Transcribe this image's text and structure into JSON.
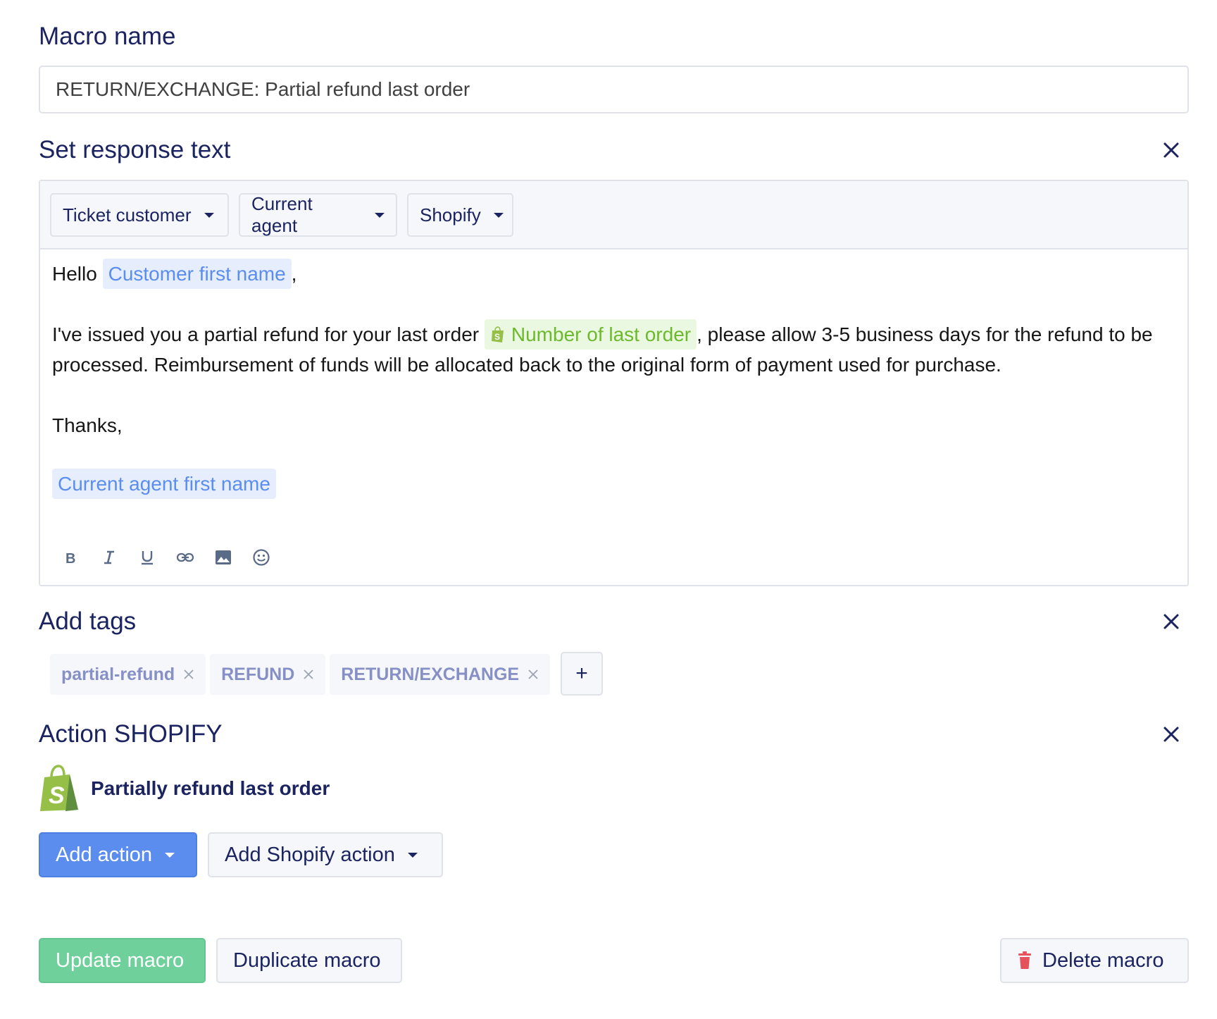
{
  "macro_name": {
    "label": "Macro name",
    "value": "RETURN/EXCHANGE: Partial refund last order"
  },
  "response": {
    "title": "Set response text",
    "variable_dropdowns": [
      "Ticket customer",
      "Current agent",
      "Shopify"
    ],
    "greeting": "Hello",
    "customer_var": "Customer first name",
    "comma": ",",
    "body_before": "I've issued you a partial refund for your last order",
    "order_var": "Number of last order",
    "body_after": ", please allow 3-5 business days for the refund to be processed. Reimbursement of funds will be allocated back to the original form of payment used for purchase.",
    "thanks": "Thanks,",
    "agent_var": "Current agent first name",
    "format_tools": [
      "bold-icon",
      "italic-icon",
      "underline-icon",
      "link-icon",
      "image-icon",
      "emoji-icon"
    ]
  },
  "tags": {
    "title": "Add tags",
    "items": [
      "partial-refund",
      "REFUND",
      "RETURN/EXCHANGE"
    ],
    "add_label": "+"
  },
  "shopify_action": {
    "title": "Action SHOPIFY",
    "action_label": "Partially refund last order",
    "add_action_label": "Add action",
    "add_shopify_action_label": "Add Shopify action"
  },
  "footer": {
    "update_label": "Update macro",
    "duplicate_label": "Duplicate macro",
    "delete_label": "Delete macro"
  },
  "colors": {
    "heading": "#1b2460",
    "primary": "#5b8def",
    "success": "#6fd09c",
    "shopify_green": "#95bf47",
    "danger": "#e5525b",
    "tag_text": "#8790c6"
  }
}
